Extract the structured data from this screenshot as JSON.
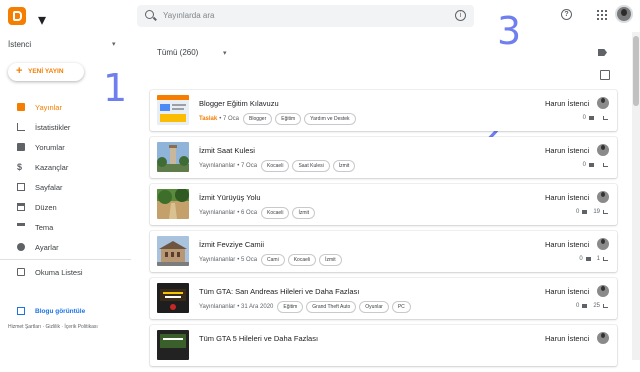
{
  "header": {
    "search_placeholder": "Yayınlarda ara",
    "help_symbol": "?",
    "info_symbol": "i"
  },
  "annotations": [
    "1",
    "2",
    "3"
  ],
  "sidebar": {
    "blog_name": "İstenci",
    "new_post_label": "YENİ YAYIN",
    "items": [
      {
        "label": "Yayınlar",
        "icon": "posts-icon",
        "active": true
      },
      {
        "label": "İstatistikler",
        "icon": "stats-icon"
      },
      {
        "label": "Yorumlar",
        "icon": "comments-icon"
      },
      {
        "label": "Kazançlar",
        "icon": "earnings-icon"
      },
      {
        "label": "Sayfalar",
        "icon": "pages-icon"
      },
      {
        "label": "Düzen",
        "icon": "layout-icon"
      },
      {
        "label": "Tema",
        "icon": "theme-icon"
      },
      {
        "label": "Ayarlar",
        "icon": "settings-icon"
      },
      {
        "label": "Okuma Listesi",
        "icon": "reading-list-icon"
      }
    ],
    "view_blog_label": "Blogu görüntüle",
    "footer_links": "Hizmet Şartları · Gizlilik · İçerik Politikası"
  },
  "main": {
    "filter_label": "Tümü (260)",
    "posts": [
      {
        "title": "Blogger Eğitim Kılavuzu",
        "status": "Taslak",
        "draft": true,
        "date": "• 7 Oca",
        "labels": [
          "Blogger",
          "Eğitim",
          "Yardım ve Destek"
        ],
        "author": "Harun İstenci",
        "comments": "0",
        "views": ""
      },
      {
        "title": "İzmit Saat Kulesi",
        "status": "Yayınlananlar",
        "date": "• 7 Oca",
        "labels": [
          "Kocaeli",
          "Saat Kulesi",
          "İzmit"
        ],
        "author": "Harun İstenci",
        "comments": "0",
        "views": ""
      },
      {
        "title": "İzmit Yürüyüş Yolu",
        "status": "Yayınlananlar",
        "date": "• 6 Oca",
        "labels": [
          "Kocaeli",
          "İzmit"
        ],
        "author": "Harun İstenci",
        "comments": "0",
        "views": "19"
      },
      {
        "title": "İzmit Fevziye Camii",
        "status": "Yayınlananlar",
        "date": "• 5 Oca",
        "labels": [
          "Cami",
          "Kocaeli",
          "İzmit"
        ],
        "author": "Harun İstenci",
        "comments": "0",
        "views": "1"
      },
      {
        "title": "Tüm GTA: San Andreas Hileleri ve Daha Fazlası",
        "status": "Yayınlananlar",
        "date": "• 31 Ara 2020",
        "labels": [
          "Eğitim",
          "Grand Theft Auto",
          "Oyunlar",
          "PC"
        ],
        "author": "Harun İstenci",
        "comments": "0",
        "views": "25"
      },
      {
        "title": "Tüm GTA 5 Hileleri ve Daha Fazlası",
        "status": "",
        "date": "",
        "labels": [],
        "author": "Harun İstenci",
        "comments": "",
        "views": ""
      }
    ]
  }
}
